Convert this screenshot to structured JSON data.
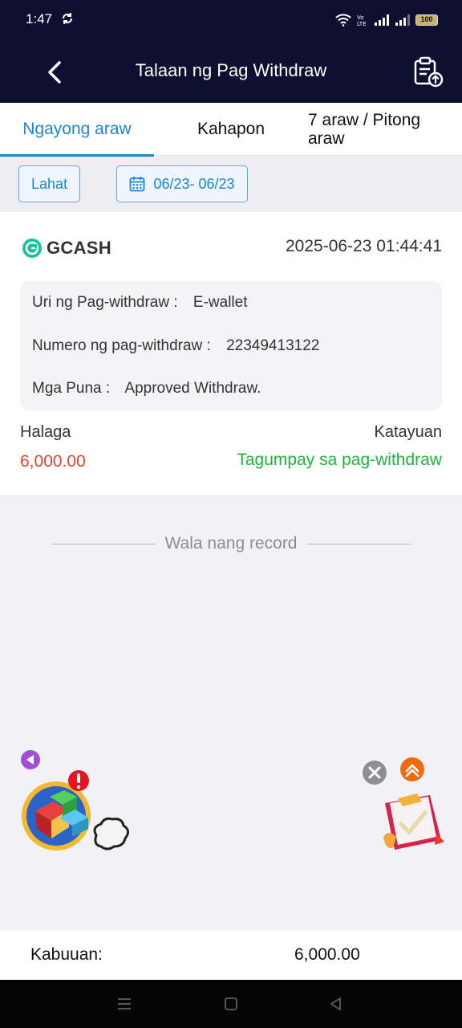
{
  "status_bar": {
    "time": "1:47",
    "battery": "100",
    "icons": [
      "sync-icon",
      "wifi-icon",
      "volte-icon",
      "signal-icon",
      "signal-icon",
      "battery-icon"
    ]
  },
  "header": {
    "title": "Talaan ng Pag Withdraw",
    "back_icon": "chevron-left-icon",
    "record_icon": "clipboard-upload-icon"
  },
  "tabs": [
    {
      "label": "Ngayong araw",
      "active": true
    },
    {
      "label": "Kahapon",
      "active": false
    },
    {
      "label": "7 araw / Pitong araw",
      "active": false
    }
  ],
  "filters": {
    "all_label": "Lahat",
    "date_range": "06/23- 06/23",
    "date_icon": "calendar-icon"
  },
  "record": {
    "method": "GCASH",
    "datetime": "2025-06-23 01:44:41",
    "type_label": "Uri ng Pag-withdraw :",
    "type_value": "E-wallet",
    "number_label": "Numero ng pag-withdraw :",
    "number_value": "22349413122",
    "remarks_label": "Mga Puna :",
    "remarks_value": "Approved Withdraw.",
    "amount_label": "Halaga",
    "amount_value": "6,000.00",
    "status_label": "Katayuan",
    "status_value": "Tagumpay sa pag-withdraw"
  },
  "empty_text": "Wala nang record",
  "total": {
    "label": "Kabuuan:",
    "value": "6,000.00"
  },
  "colors": {
    "header_bg": "#0d1030",
    "accent": "#1a86d6",
    "amount": "#e5412b",
    "success": "#1fb43a"
  }
}
